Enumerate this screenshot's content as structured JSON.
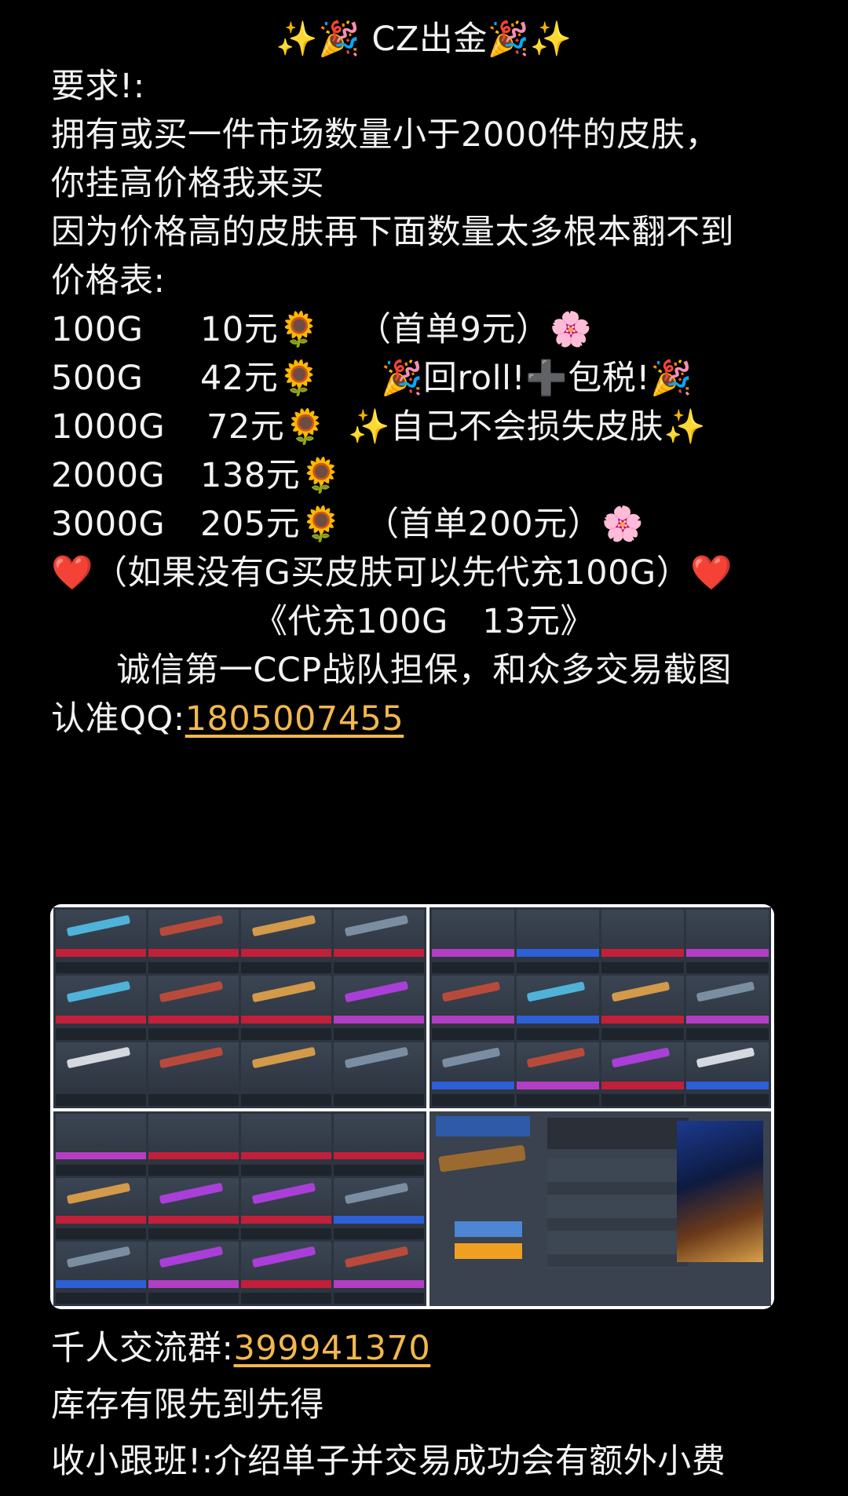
{
  "title": "✨🎉 CZ出金🎉✨",
  "requirements_label": "要求!:",
  "req_line1": "拥有或买一件市场数量小于2000件的皮肤，",
  "req_line2": "你挂高价格我来买",
  "req_line3": "因为价格高的皮肤再下面数量太多根本翻不到",
  "price_table_label": "价格表:",
  "price_rows": [
    {
      "amount": "100G",
      "price": "10元🌻",
      "note": "（首单9元）🌸"
    },
    {
      "amount": "500G",
      "price": "42元🌻",
      "note": "🎉回roll!➕包税!🎉"
    },
    {
      "amount": "1000G",
      "price": "72元🌻",
      "note": "✨自己不会损失皮肤✨"
    },
    {
      "amount": "2000G",
      "price": "138元🌻",
      "note": ""
    },
    {
      "amount": "3000G",
      "price": "205元🌻",
      "note": "（首单200元）🌸"
    }
  ],
  "topup_line": "❤️（如果没有G买皮肤可以先代充100G）❤️",
  "topup_price": "《代充100G　13元》",
  "trust_line": "诚信第一CCP战队担保，和众多交易截图",
  "qq_label": "认准QQ:",
  "qq_number": "1805007455",
  "group_label": "千人交流群:",
  "group_number": "399941370",
  "stock_line": "库存有限先到先得",
  "referral_line": "收小跟班!:介绍单子并交易成功会有额外小费",
  "colors": {
    "link": "#f2b84b",
    "background": "#000000",
    "text": "#f2f2f2"
  }
}
